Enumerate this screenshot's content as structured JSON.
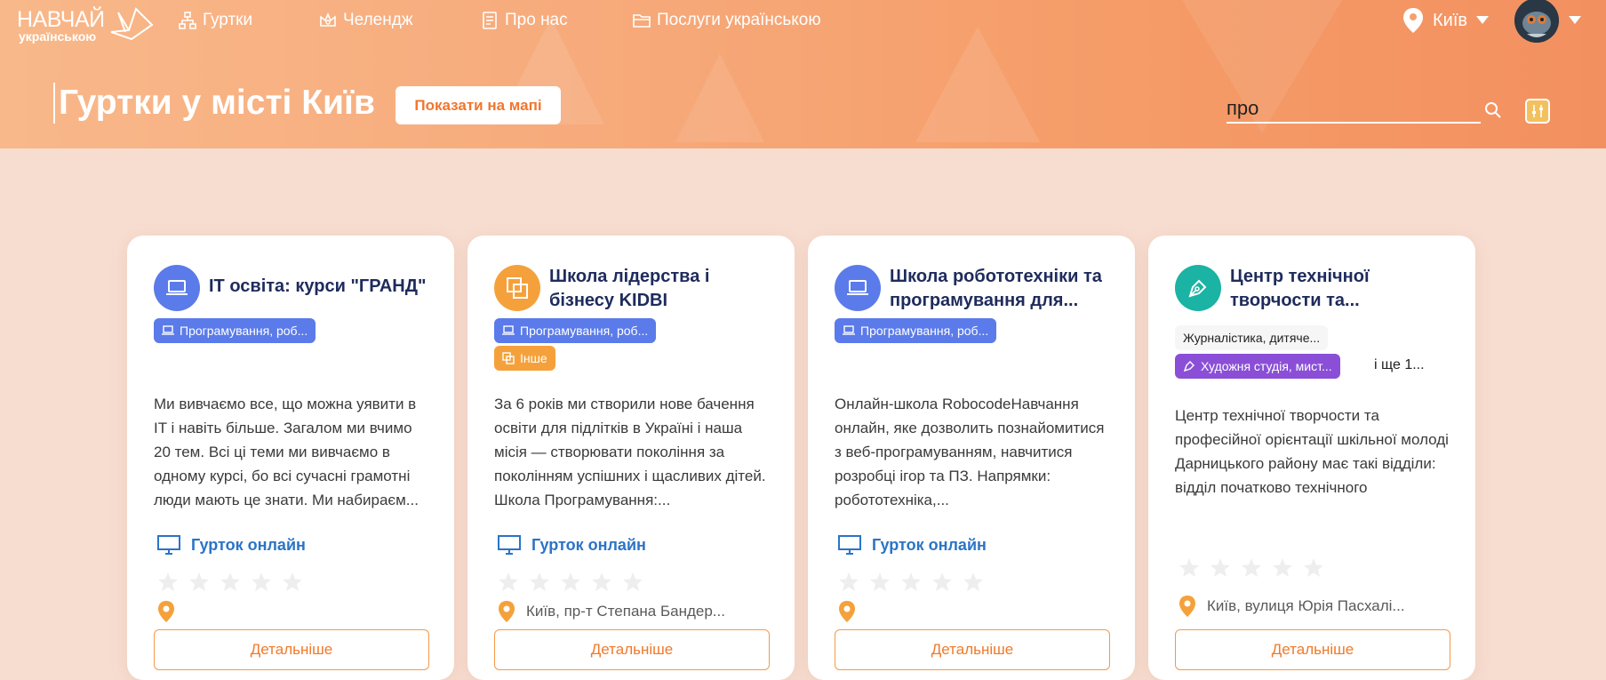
{
  "nav": {
    "logo_main": "НАВЧАЙ",
    "logo_sub": "українською",
    "items": [
      {
        "label": "Гуртки",
        "icon": "hierarchy-icon"
      },
      {
        "label": "Челендж",
        "icon": "crown-icon"
      },
      {
        "label": "Про нас",
        "icon": "document-icon"
      },
      {
        "label": "Послуги українською",
        "icon": "folder-icon"
      }
    ],
    "city": "Київ"
  },
  "header": {
    "title": "Гуртки у місті Київ",
    "map_button": "Показати на мапі",
    "search_value": "про"
  },
  "colors": {
    "accent": "#f07a2a",
    "title": "#1e2b5c",
    "badge_blue": "#5b7bea",
    "badge_orange": "#f5a13b",
    "badge_purple": "#8a4fd6",
    "online": "#2b74c7"
  },
  "cards": [
    {
      "title": "IT освіта: курси \"ГРАНД\"",
      "icon": "laptop-icon",
      "badges": [
        {
          "label": "Програмування, роб...",
          "color": "blue",
          "icon": "laptop-icon"
        }
      ],
      "description": "Ми вивчаємо все, що можна уявити в IT і навіть більше. Загалом ми вчимо 20 тем. Всі ці теми ми вивчаємо в одному курсі, бо всі сучасні грамотні люди мають це знати. Ми набираєм...",
      "online": "Гурток онлайн",
      "rating": 0,
      "address": "",
      "details": "Детальніше"
    },
    {
      "title": "Школа лідерства і бізнесу KIDBI",
      "icon": "squares-icon",
      "badges": [
        {
          "label": "Програмування, роб...",
          "color": "blue",
          "icon": "laptop-icon"
        },
        {
          "label": "Інше",
          "color": "orange",
          "icon": "squares-icon"
        }
      ],
      "description": "За 6 років ми створили нове бачення освіти для підлітків в Україні і наша місія — створювати покоління за поколінням успішних і щасливих дітей. Школа Програмування:...",
      "online": "Гурток онлайн",
      "rating": 0,
      "address": "Київ, пр-т Степана Бандер...",
      "details": "Детальніше"
    },
    {
      "title": "Школа робототехніки та програмування для...",
      "icon": "laptop-icon",
      "badges": [
        {
          "label": "Програмування, роб...",
          "color": "blue",
          "icon": "laptop-icon"
        }
      ],
      "description": "Онлайн-школа RobocodeНавчання онлайн, яке дозволить познайомитися з веб-програмуванням, навчитися розробці ігор та ПЗ. Напрямки: робототехніка,...",
      "online": "Гурток онлайн",
      "rating": 0,
      "address": "",
      "details": "Детальніше"
    },
    {
      "title": "Центр технічної творчости та...",
      "icon": "pen-icon",
      "badges": [
        {
          "label": "Журналістика, дитяче...",
          "color": "plain",
          "icon": ""
        },
        {
          "label": "Художня студія, мист...",
          "color": "purple",
          "icon": "pen-icon"
        }
      ],
      "more": "і ще 1...",
      "description": "Центр технічної творчости та професійної орієнтації шкільної молоді Дарницького району має такі відділи: відділ початково технічного моделювання (\"Моделювання та...",
      "online": "",
      "rating": 0,
      "address": "Київ, вулиця Юрія Пасхалі...",
      "details": "Детальніше"
    }
  ]
}
